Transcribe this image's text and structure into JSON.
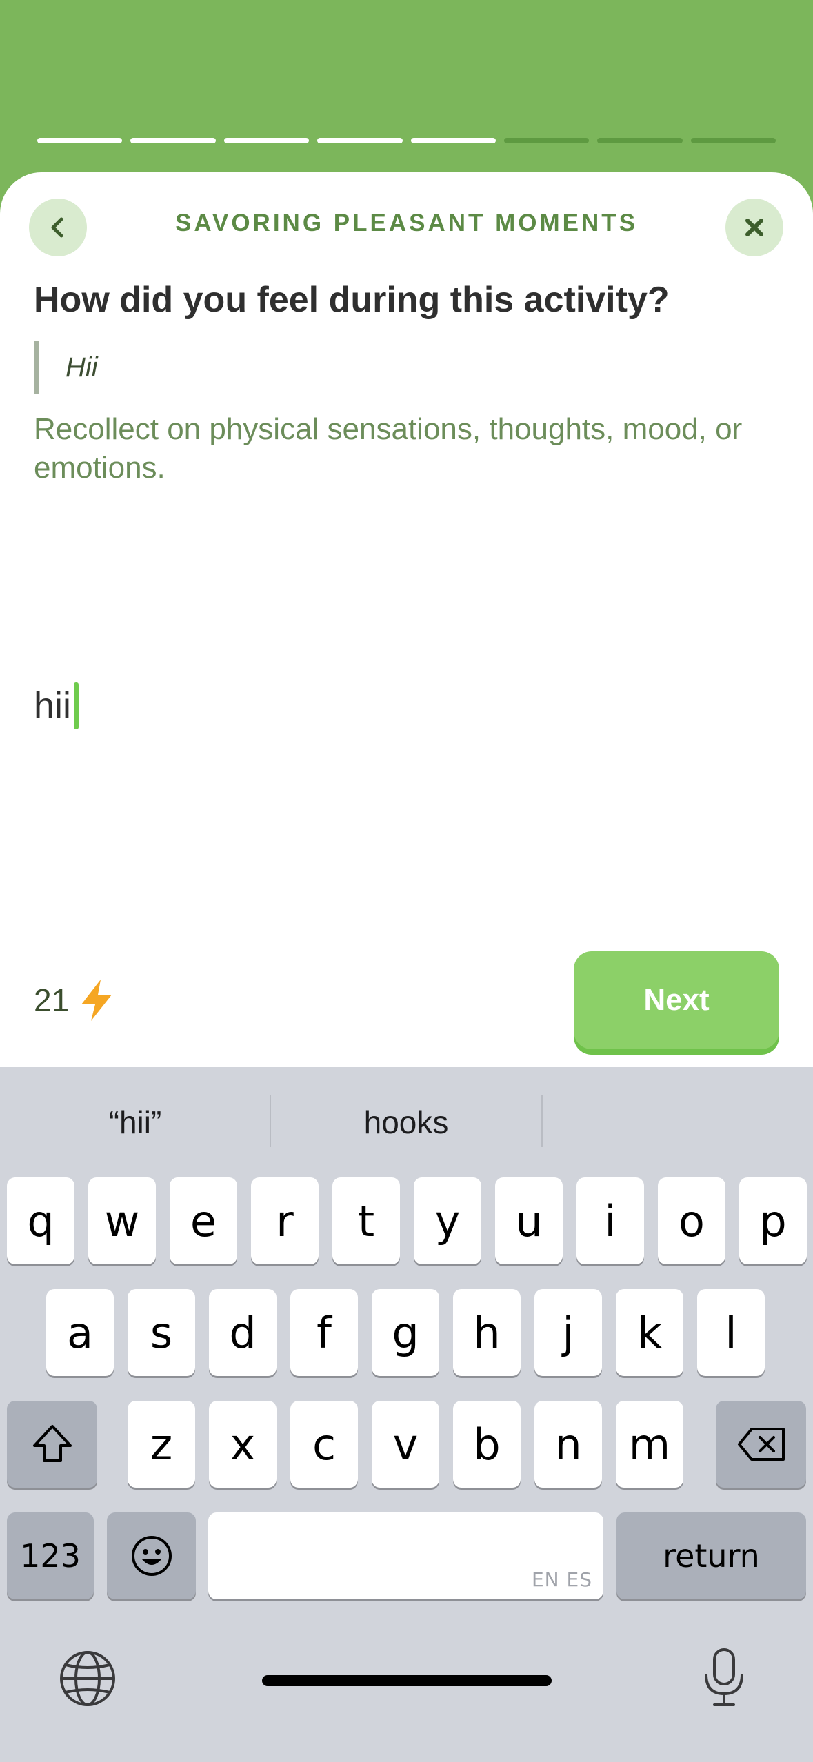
{
  "progress": {
    "total": 8,
    "completed": 5
  },
  "header": {
    "title": "SAVORING PLEASANT MOMENTS"
  },
  "question": "How did you feel during this activity?",
  "quote": "Hii",
  "hint": "Recollect on physical sensations, thoughts, mood, or emotions.",
  "answer": "hii",
  "points": "21",
  "next_label": "Next",
  "keyboard": {
    "suggestions": [
      "“hii”",
      "hooks",
      ""
    ],
    "row1": [
      "q",
      "w",
      "e",
      "r",
      "t",
      "y",
      "u",
      "i",
      "o",
      "p"
    ],
    "row2": [
      "a",
      "s",
      "d",
      "f",
      "g",
      "h",
      "j",
      "k",
      "l"
    ],
    "row3": [
      "z",
      "x",
      "c",
      "v",
      "b",
      "n",
      "m"
    ],
    "numbers_label": "123",
    "space_sub": "EN ES",
    "return_label": "return"
  },
  "colors": {
    "brand_green": "#7cb65b",
    "button_green": "#8cd068",
    "title_green": "#5c8a45"
  },
  "icons": {
    "back": "chevron-left-icon",
    "close": "close-icon",
    "points": "lightning-bolt-icon",
    "shift": "shift-icon",
    "delete": "backspace-icon",
    "emoji": "emoji-icon",
    "globe": "globe-icon",
    "mic": "microphone-icon"
  }
}
